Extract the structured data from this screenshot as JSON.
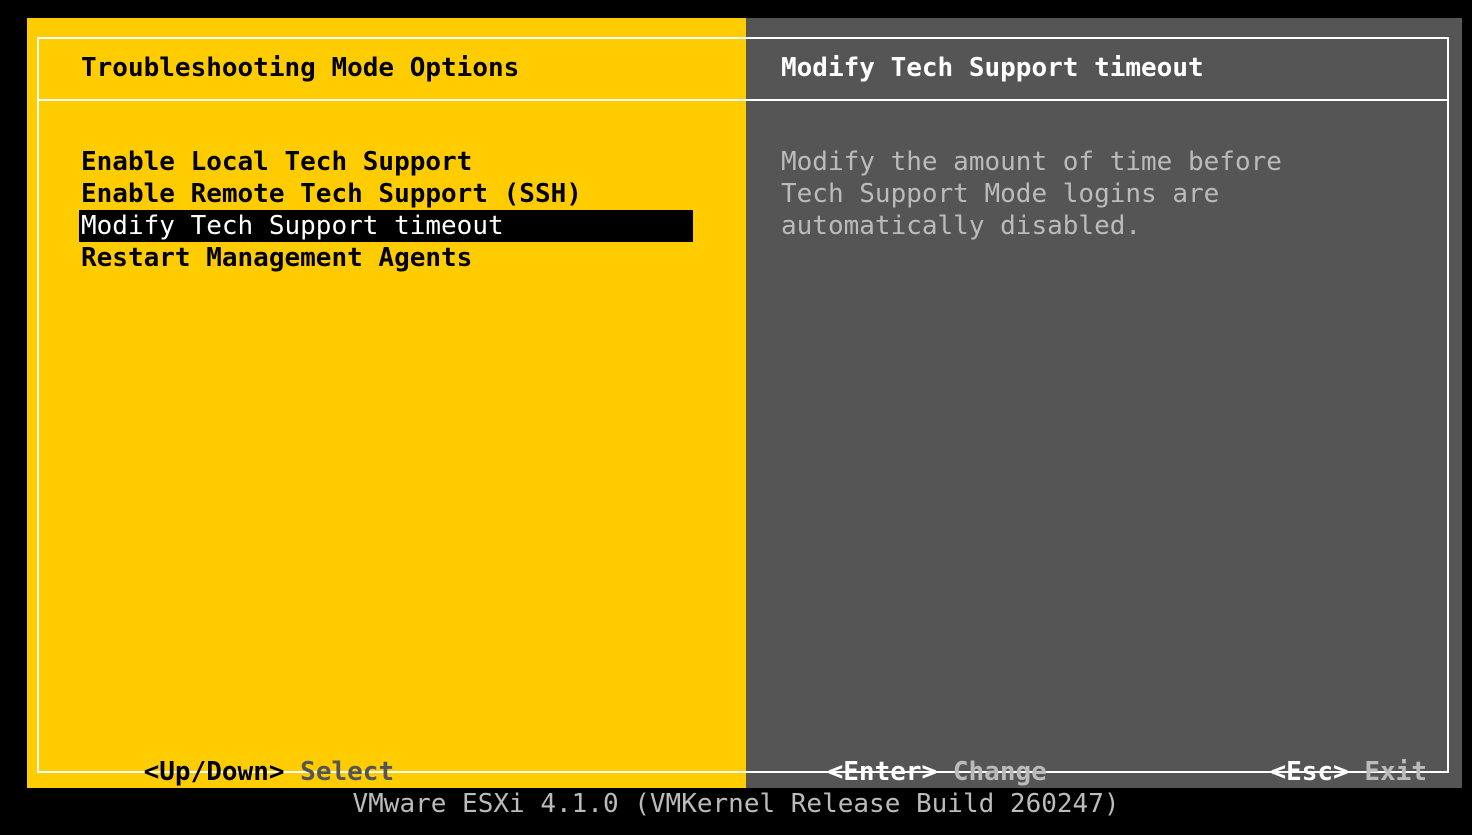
{
  "left_panel": {
    "title": "Troubleshooting Mode Options",
    "menu_items": [
      {
        "label": "Enable Local Tech Support",
        "selected": false
      },
      {
        "label": "Enable Remote Tech Support (SSH)",
        "selected": false
      },
      {
        "label": "Modify Tech Support timeout",
        "selected": true
      },
      {
        "label": "Restart Management Agents",
        "selected": false
      }
    ],
    "footer": {
      "key": "<Up/Down>",
      "action": "Select"
    }
  },
  "right_panel": {
    "title": "Modify Tech Support timeout",
    "description_lines": [
      "Modify the amount of time before",
      "Tech Support Mode logins are",
      "automatically disabled."
    ],
    "footer_left": {
      "key": "<Enter>",
      "action": "Change"
    },
    "footer_right": {
      "key": "<Esc>",
      "action": "Exit"
    }
  },
  "status_bar": {
    "text": "VMware ESXi 4.1.0 (VMKernel Release Build 260247)"
  },
  "colors": {
    "left_background": "#FFCC00",
    "right_background": "#555555",
    "screen_background": "#000000",
    "selection_background": "#000000",
    "frame": "#FFFFFF"
  }
}
